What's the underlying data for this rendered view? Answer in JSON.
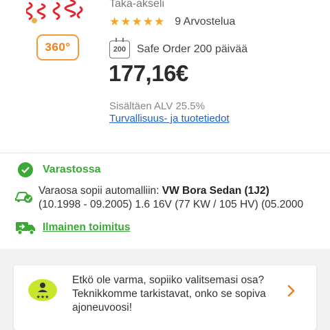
{
  "product": {
    "axle": "Taka-akseli",
    "rating": {
      "stars": 5,
      "stars_glyphs": "★★★★★",
      "reviews": "9 Arvostelua"
    },
    "view_360_label": "360°",
    "safe_order": {
      "badge": "200",
      "text": "Safe Order 200 päivää"
    },
    "price": "177,16€",
    "vat": "Sisältäen ALV 25.5%",
    "safety_link": "Turvallisuus- ja tuotetiedot"
  },
  "availability": {
    "stock": "Varastossa",
    "fit_prefix": "Varaosa sopii automalliin: ",
    "fit_model": "VW Bora Sedan (1J2)",
    "fit_details": "(10.1998 - 09.2005) 1.6 16V (77 KW / 105 HV) (05.2000",
    "delivery": "Ilmainen toimitus"
  },
  "help": {
    "text": "Etkö ole varma, sopiiko valitsemasi osa? Teknikkomme tarkistavat, onko se sopiva ajoneuvoosi!",
    "badge_stars": "★★★"
  },
  "colors": {
    "green": "#3aa935",
    "link_blue": "#1e62c9",
    "star_orange": "#f5a623",
    "badge_green": "#c8e62d",
    "arrow_orange": "#f07f16",
    "spring_red": "#e3262e"
  },
  "icons": [
    "springs-thumbnail",
    "view-360-icon",
    "star-icon",
    "calendar-200-icon",
    "check-circle-icon",
    "car-check-icon",
    "truck-icon",
    "technician-badge-icon",
    "chevron-right-icon"
  ]
}
